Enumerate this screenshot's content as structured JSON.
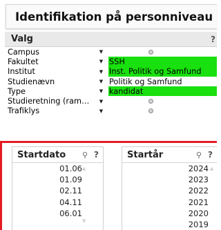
{
  "header": {
    "title": "Identifikation på personniveau"
  },
  "valg": {
    "title": "Valg",
    "help_glyph": "?",
    "rows": [
      {
        "label": "Campus",
        "value": "",
        "selected": false
      },
      {
        "label": "Fakultet",
        "value": "SSH",
        "selected": true
      },
      {
        "label": "Institut",
        "value": "Inst. Politik og Samfund",
        "selected": true
      },
      {
        "label": "Studienævn",
        "value": "Politik og Samfund",
        "selected": false
      },
      {
        "label": "Type",
        "value": "kandidat",
        "selected": true
      },
      {
        "label": "Studieretning (ram…",
        "value": "",
        "selected": false
      },
      {
        "label": "Trafiklys",
        "value": "",
        "selected": false
      }
    ]
  },
  "lists": {
    "startdato": {
      "title": "Startdato",
      "items": [
        "01.06",
        "01.09",
        "02.11",
        "04.11",
        "06.01"
      ]
    },
    "startaar": {
      "title": "Startår",
      "items": [
        "2024",
        "2023",
        "2022",
        "2021",
        "2020",
        "2019"
      ]
    }
  },
  "colors": {
    "selected_green": "#19e00f",
    "frame_red": "#e31b23"
  }
}
